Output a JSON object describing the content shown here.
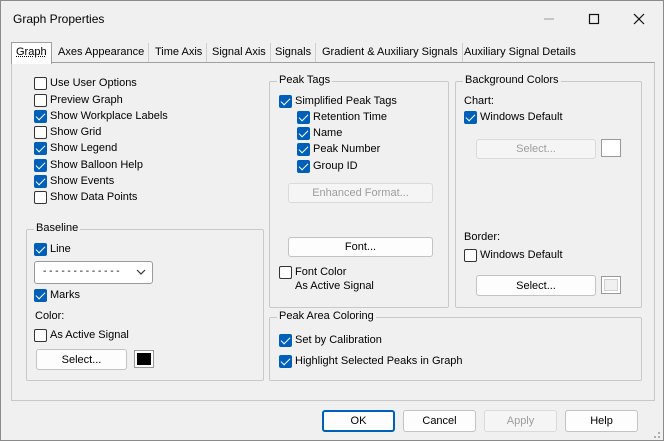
{
  "window": {
    "title": "Graph Properties"
  },
  "tabs": [
    {
      "label": "Graph",
      "active": true
    },
    {
      "label": "Axes Appearance"
    },
    {
      "label": "Time Axis"
    },
    {
      "label": "Signal Axis"
    },
    {
      "label": "Signals"
    },
    {
      "label": "Gradient & Auxiliary Signals"
    },
    {
      "label": "Auxiliary Signal Details"
    }
  ],
  "options": {
    "items": [
      {
        "label": "Use User Options",
        "checked": false
      },
      {
        "label": "Preview Graph",
        "checked": false
      },
      {
        "label": "Show Workplace Labels",
        "checked": true
      },
      {
        "label": "Show Grid",
        "checked": false
      },
      {
        "label": "Show Legend",
        "checked": true
      },
      {
        "label": "Show Balloon Help",
        "checked": true
      },
      {
        "label": "Show Events",
        "checked": true
      },
      {
        "label": "Show Data Points",
        "checked": false
      }
    ]
  },
  "baseline": {
    "title": "Baseline",
    "line_label": "Line",
    "line_checked": true,
    "line_style": "- - - - - - - - - - - - -",
    "marks_label": "Marks",
    "marks_checked": true,
    "color_label": "Color:",
    "as_active_label": "As Active Signal",
    "as_active_checked": false,
    "select_label": "Select...",
    "color": "#000000"
  },
  "peak_tags": {
    "title": "Peak Tags",
    "simplified_label": "Simplified Peak Tags",
    "simplified_checked": true,
    "sub_items": [
      {
        "label": "Retention Time",
        "checked": true
      },
      {
        "label": "Name",
        "checked": true
      },
      {
        "label": "Peak Number",
        "checked": true
      },
      {
        "label": "Group ID",
        "checked": true
      }
    ],
    "enhanced_label": "Enhanced Format...",
    "font_label": "Font...",
    "font_color_label": "Font Color",
    "font_color_sub": "As Active Signal",
    "font_color_checked": false
  },
  "background": {
    "title": "Background Colors",
    "chart_label": "Chart:",
    "chart_default_label": "Windows Default",
    "chart_default_checked": true,
    "chart_select_label": "Select...",
    "border_label": "Border:",
    "border_default_label": "Windows Default",
    "border_default_checked": false,
    "border_select_label": "Select..."
  },
  "peak_area": {
    "title": "Peak Area Coloring",
    "items": [
      {
        "label": "Set by Calibration",
        "checked": true
      },
      {
        "label": "Highlight Selected Peaks in Graph",
        "checked": true
      }
    ]
  },
  "footer": {
    "ok": "OK",
    "cancel": "Cancel",
    "apply": "Apply",
    "help": "Help"
  },
  "colors": {
    "accent": "#005fb8",
    "window_bg": "#f0f0f0"
  }
}
